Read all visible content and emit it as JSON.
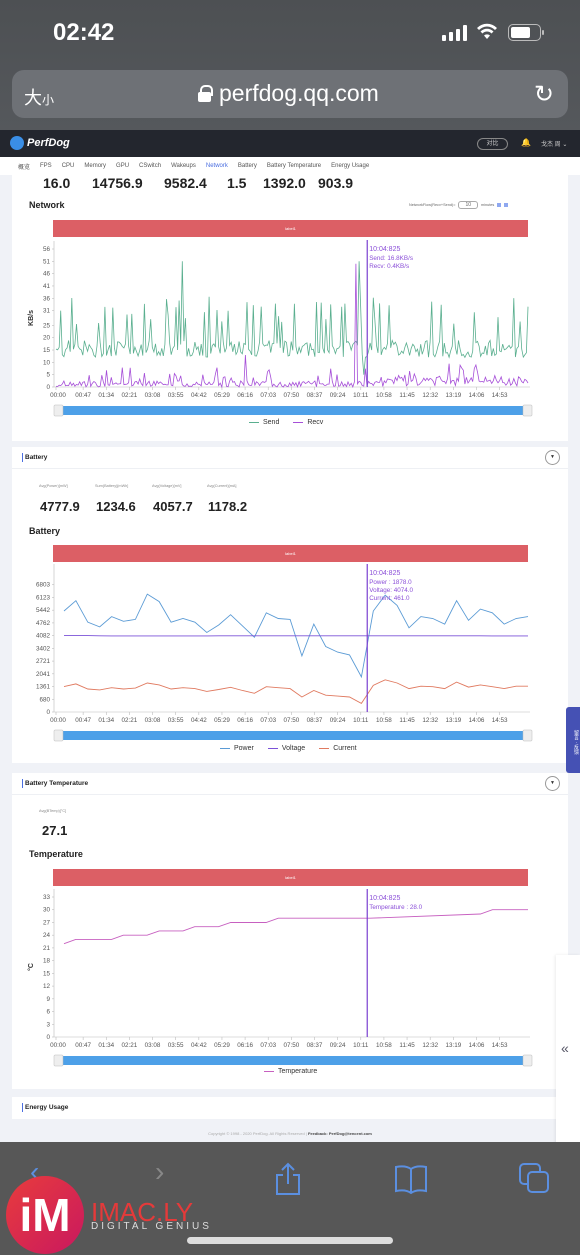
{
  "status_bar": {
    "time": "02:42"
  },
  "browser": {
    "text_size_label": "大",
    "text_size_small": "小",
    "url": "perfdog.qq.com"
  },
  "app": {
    "name": "PerfDog",
    "compare_button": "对比",
    "user": "戈杰 周 ⌄"
  },
  "tabs": [
    {
      "label": "概览",
      "active": false
    },
    {
      "label": "FPS",
      "active": false
    },
    {
      "label": "CPU",
      "active": false
    },
    {
      "label": "Memory",
      "active": false
    },
    {
      "label": "GPU",
      "active": false
    },
    {
      "label": "CSwitch",
      "active": false
    },
    {
      "label": "Wakeups",
      "active": false
    },
    {
      "label": "Network",
      "active": true
    },
    {
      "label": "Battery",
      "active": false
    },
    {
      "label": "Battery Temperature",
      "active": false
    },
    {
      "label": "Energy Usage",
      "active": false
    }
  ],
  "top_values": [
    "16.0",
    "14756.9",
    "9582.4",
    "1.5",
    "1392.0",
    "903.9"
  ],
  "network": {
    "title": "Network",
    "flow_label": "NetworkFlow(Recv+Send)=",
    "minutes_value": "10",
    "minutes_label": "minutes",
    "red_bar_label": "label1",
    "cursor": {
      "time": "10:04:825",
      "lines": [
        "Send: 16.8KB/s",
        "Recv: 0.4KB/s"
      ]
    }
  },
  "battery": {
    "section_title": "Battery",
    "metrics": [
      {
        "label": "Avg(Power)[mW]",
        "value": "4777.9"
      },
      {
        "label": "Sum(Battery)[mWh]",
        "value": "1234.6"
      },
      {
        "label": "Avg(Voltage)[mV]",
        "value": "4057.7"
      },
      {
        "label": "Avg(Current)[mA]",
        "value": "1178.2"
      }
    ],
    "chart_title": "Battery",
    "red_bar_label": "label1",
    "cursor": {
      "time": "10:04:825",
      "lines": [
        "Power  : 1878.0",
        "Voltage: 4074.0",
        "Current: 461.0"
      ]
    }
  },
  "battery_temperature": {
    "section_title": "Battery Temperature",
    "metrics": [
      {
        "label": "Avg(BTemp)[°C]",
        "value": "27.1"
      }
    ],
    "chart_title": "Temperature",
    "red_bar_label": "label1",
    "cursor": {
      "time": "10:04:825",
      "lines": [
        "Temperature : 28.0"
      ]
    }
  },
  "energy_usage": {
    "section_title": "Energy Usage"
  },
  "footer": {
    "copyright": "Copyright © 1998 - 2020 PerfDog. All Rights Reserved | ",
    "feedback": "Feedback: PerfDog@tencent.com"
  },
  "feedback_tab": "留言 · 反馈",
  "side_panel_icon": "«",
  "watermark": {
    "logo": "iM",
    "name": "IMAC.LY",
    "tagline": "DIGITAL GENIUS"
  },
  "chart_data": [
    {
      "type": "line",
      "title": "Network",
      "ylabel": "KB/s",
      "xlabel": "",
      "x_ticks": [
        "00:00",
        "00:47",
        "01:34",
        "02:21",
        "03:08",
        "03:55",
        "04:42",
        "05:29",
        "06:16",
        "07:03",
        "07:50",
        "08:37",
        "09:24",
        "10:11",
        "10:58",
        "11:45",
        "12:32",
        "13:19",
        "14:06",
        "14:53"
      ],
      "y_ticks": [
        0,
        5,
        10,
        15,
        20,
        25,
        31,
        36,
        41,
        46,
        51,
        56
      ],
      "ylim": [
        0,
        56
      ],
      "legend": "bottom",
      "series": [
        {
          "name": "Send",
          "color": "#5aaf8f",
          "summary": "fluctuating 10-20 KB/s with frequent spikes to 30-36, max ~51 near 02:21 and ~51 near 09:45"
        },
        {
          "name": "Recv",
          "color": "#a64fd8",
          "summary": "mostly 0-5 KB/s with occasional spikes, peak ~13 near 04:50 and ~50 near 09:45"
        }
      ],
      "cursor_x": "10:04"
    },
    {
      "type": "line",
      "title": "Battery",
      "x_ticks": [
        "00:00",
        "00:47",
        "01:34",
        "02:21",
        "03:08",
        "03:55",
        "04:42",
        "05:29",
        "06:16",
        "07:03",
        "07:50",
        "08:37",
        "09:24",
        "10:11",
        "10:58",
        "11:45",
        "12:32",
        "13:19",
        "14:06",
        "14:53"
      ],
      "y_ticks": [
        0,
        680,
        1361,
        2041,
        2721,
        3402,
        4082,
        4762,
        5442,
        6123,
        6803
      ],
      "ylim": [
        0,
        7483
      ],
      "legend": "bottom",
      "x": [
        "00:00",
        "00:23",
        "00:47",
        "01:10",
        "01:34",
        "01:57",
        "02:21",
        "02:44",
        "03:08",
        "03:31",
        "03:55",
        "04:18",
        "04:42",
        "05:05",
        "05:29",
        "05:52",
        "06:16",
        "06:39",
        "07:03",
        "07:26",
        "07:50",
        "08:13",
        "08:37",
        "09:00",
        "09:24",
        "09:47",
        "10:04",
        "10:35",
        "10:58",
        "11:21",
        "11:45",
        "12:08",
        "12:32",
        "12:55",
        "13:19",
        "13:42",
        "14:06",
        "14:29",
        "14:53",
        "15:16"
      ],
      "series": [
        {
          "name": "Power",
          "color": "#5b9bd5",
          "values": [
            5400,
            5950,
            4800,
            4550,
            5100,
            4850,
            4950,
            6300,
            5900,
            4800,
            5000,
            4800,
            4250,
            4650,
            5200,
            4600,
            4000,
            5300,
            5000,
            4950,
            3000,
            4700,
            3500,
            3200,
            3050,
            1878,
            5400,
            6250,
            5700,
            4500,
            5100,
            5000,
            4700,
            5950,
            4900,
            5500,
            5300,
            4700,
            5000,
            5100
          ]
        },
        {
          "name": "Voltage",
          "color": "#7b52d8",
          "values": [
            4082,
            4082,
            4082,
            4075,
            4070,
            4070,
            4068,
            4065,
            4065,
            4068,
            4068,
            4070,
            4070,
            4072,
            4074,
            4074,
            4074,
            4074,
            4074,
            4074,
            4074,
            4074,
            4074,
            4074,
            4074,
            4074,
            4074,
            4074,
            4074,
            4074,
            4074,
            4074,
            4074,
            4074,
            4074,
            4074,
            4070,
            4070,
            4070,
            4070
          ]
        },
        {
          "name": "Current",
          "color": "#e07a60",
          "values": [
            1360,
            1500,
            1230,
            1180,
            1300,
            1230,
            1280,
            1550,
            1450,
            1230,
            1300,
            1250,
            1100,
            1200,
            1320,
            1150,
            1000,
            1350,
            1300,
            1250,
            800,
            1150,
            900,
            850,
            800,
            461,
            1420,
            1720,
            1550,
            1250,
            1380,
            1350,
            1250,
            1600,
            1330,
            1450,
            1350,
            1250,
            1380,
            1380
          ]
        }
      ],
      "cursor_x": "10:04"
    },
    {
      "type": "line",
      "title": "Temperature",
      "ylabel": "°C",
      "x_ticks": [
        "00:00",
        "00:47",
        "01:34",
        "02:21",
        "03:08",
        "03:55",
        "04:42",
        "05:29",
        "06:16",
        "07:03",
        "07:50",
        "08:37",
        "09:24",
        "10:11",
        "10:58",
        "11:45",
        "12:32",
        "13:19",
        "14:06",
        "14:53"
      ],
      "y_ticks": [
        0,
        3,
        6,
        9,
        12,
        15,
        18,
        21,
        24,
        27,
        30,
        33
      ],
      "ylim": [
        0,
        33
      ],
      "legend": "bottom",
      "series": [
        {
          "name": "Temperature",
          "color": "#c760c0",
          "x": [
            "00:00",
            "00:23",
            "01:34",
            "01:57",
            "02:44",
            "03:08",
            "03:55",
            "04:18",
            "05:05",
            "05:29",
            "06:39",
            "07:03",
            "07:26",
            "09:47",
            "10:04",
            "13:42",
            "14:06",
            "15:16"
          ],
          "values": [
            22,
            23,
            23,
            24,
            24,
            25,
            25,
            26,
            26,
            27,
            27,
            28,
            28,
            28,
            28,
            29,
            30,
            30
          ]
        }
      ],
      "cursor_x": "10:04"
    }
  ]
}
